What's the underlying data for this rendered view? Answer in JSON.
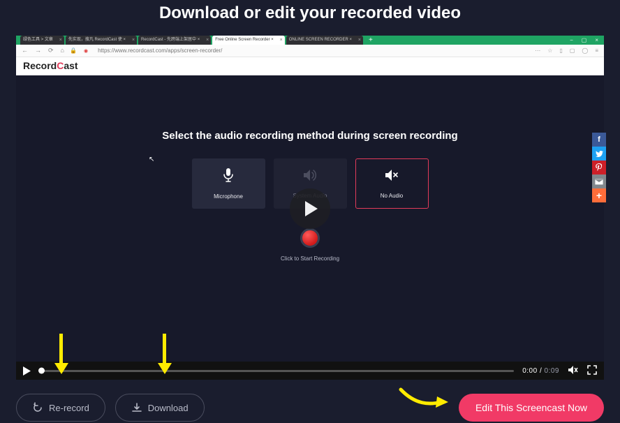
{
  "page": {
    "title": "Download or edit your recorded video"
  },
  "browser": {
    "tabs": [
      {
        "label": "绿色工具 > 文章"
      },
      {
        "label": "先实现，搜凡 RecordCast 使 ×"
      },
      {
        "label": "RecordCast - 先跨端上架居中 ×"
      },
      {
        "label": "Free Online Screen Recorder ×",
        "active": true
      },
      {
        "label": "ONLINE SCREEN RECORDER ×"
      }
    ],
    "url": "https://www.recordcast.com/apps/screen-recorder/",
    "window_controls": [
      "−",
      "▢",
      "×"
    ]
  },
  "brand": {
    "prefix": "Record",
    "accent": "C",
    "suffix": "ast"
  },
  "screen": {
    "audio_title": "Select the audio recording method during screen recording",
    "options": {
      "microphone": "Microphone",
      "system": "System Audio",
      "none": "No Audio"
    },
    "start_label": "Click to Start Recording"
  },
  "player": {
    "current": "0:00",
    "duration": "0:09"
  },
  "buttons": {
    "rerecord": "Re-record",
    "download": "Download",
    "edit": "Edit This Screencast Now"
  },
  "social": {
    "facebook": "f",
    "twitter": "",
    "pinterest": "",
    "mail": "",
    "more": "+"
  }
}
